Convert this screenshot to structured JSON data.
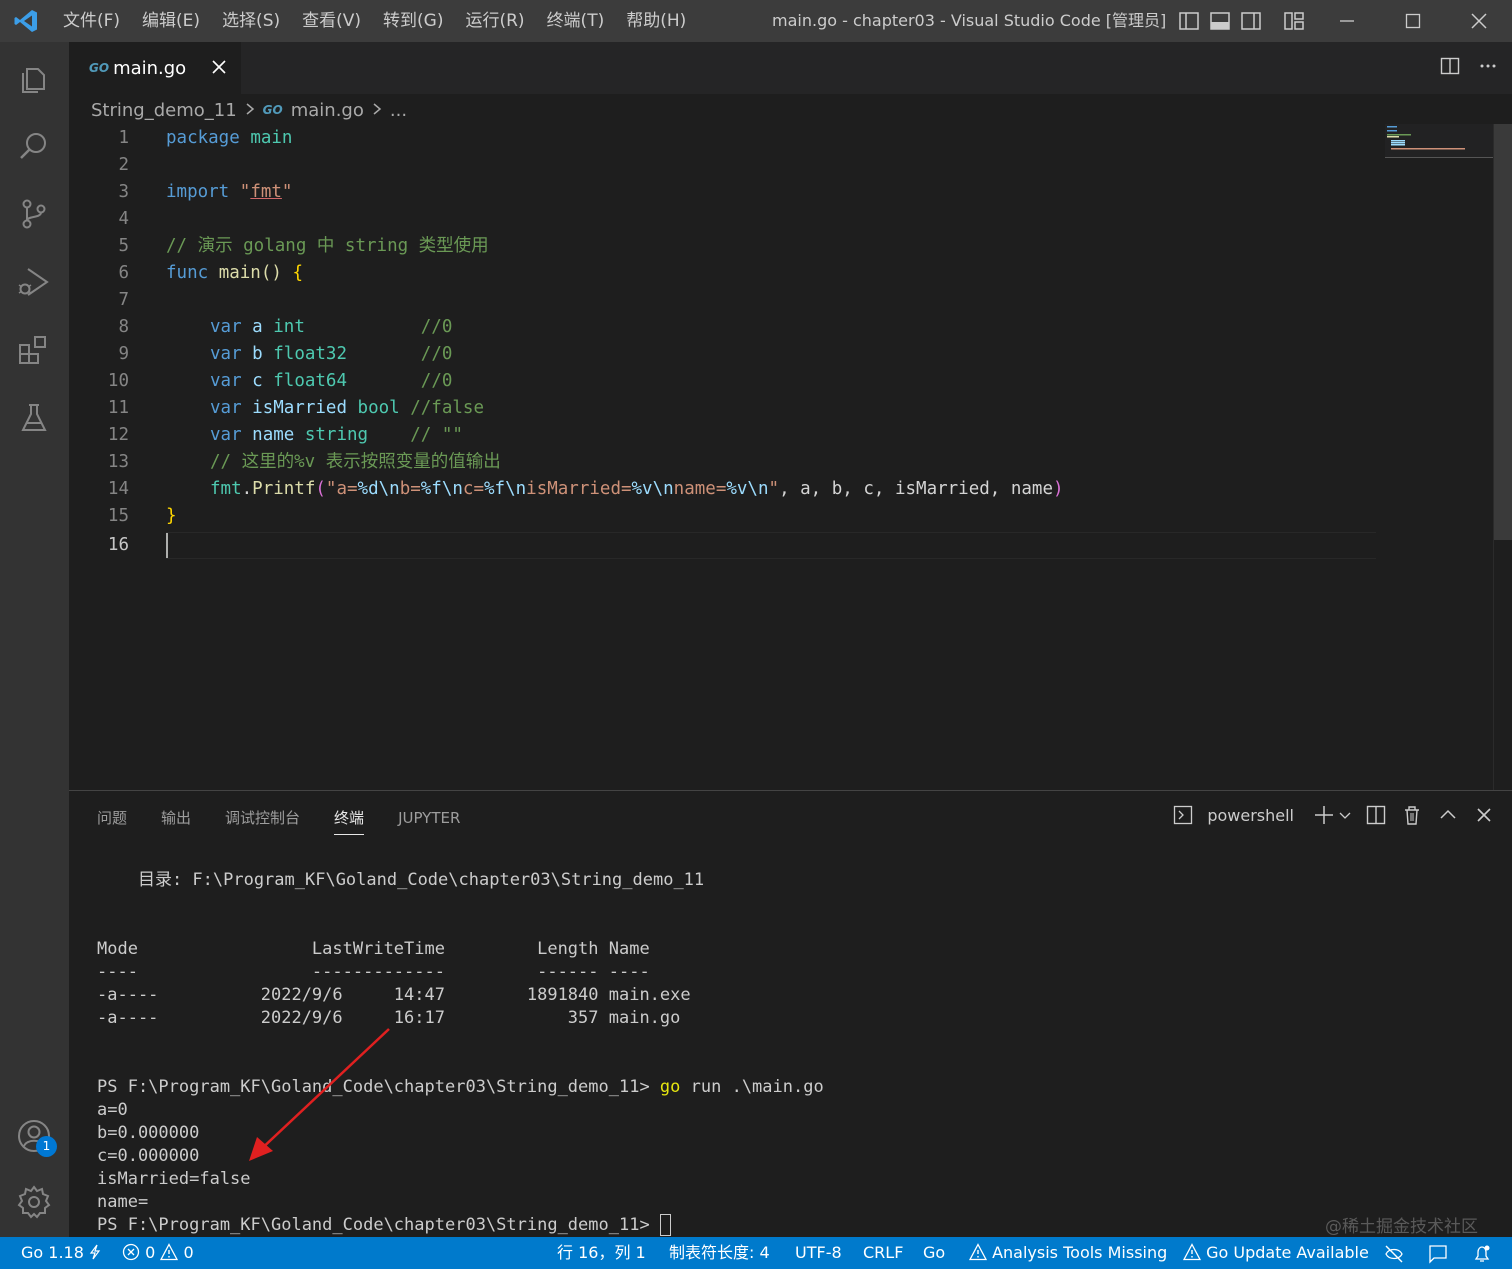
{
  "titlebar": {
    "menu": [
      "文件(F)",
      "编辑(E)",
      "选择(S)",
      "查看(V)",
      "转到(G)",
      "运行(R)",
      "终端(T)",
      "帮助(H)"
    ],
    "title": "main.go - chapter03 - Visual Studio Code [管理员]"
  },
  "tab": {
    "label": "main.go",
    "icon": "go-file-icon"
  },
  "breadcrumb": {
    "folder": "String_demo_11",
    "file": "main.go",
    "more": "..."
  },
  "editor": {
    "line_numbers": [
      "1",
      "2",
      "3",
      "4",
      "5",
      "6",
      "7",
      "8",
      "9",
      "10",
      "11",
      "12",
      "13",
      "14",
      "15",
      "16"
    ],
    "active_line": 16,
    "code": {
      "l1_kw": "package",
      "l1_id": "main",
      "l3_kw": "import",
      "l3_q1": "\"",
      "l3_str": "fmt",
      "l3_q2": "\"",
      "l5": "// 演示 golang 中 string 类型使用",
      "l6_kw": "func",
      "l6_fn": "main",
      "l6_paren": "() ",
      "l6_brace": "{",
      "l8_kw": "var",
      "l8_id": "a",
      "l8_ty": "int",
      "l8_cm": "//0",
      "l9_kw": "var",
      "l9_id": "b",
      "l9_ty": "float32",
      "l9_cm": "//0",
      "l10_kw": "var",
      "l10_id": "c",
      "l10_ty": "float64",
      "l10_cm": "//0",
      "l11_kw": "var",
      "l11_id": "isMarried",
      "l11_ty": "bool",
      "l11_cm": "//false",
      "l12_kw": "var",
      "l12_id": "name",
      "l12_ty": "string",
      "l12_cm": "// \"\"",
      "l13": "// 这里的%v 表示按照变量的值输出",
      "l14_pkg": "fmt",
      "l14_dot": ".",
      "l14_fn": "Printf",
      "l14_open": "(",
      "l14_s1": "\"a=",
      "l14_e1": "%d\\n",
      "l14_s2": "b=",
      "l14_e2": "%f\\n",
      "l14_s3": "c=",
      "l14_e3": "%f\\n",
      "l14_s4": "isMarried=",
      "l14_e4": "%v\\n",
      "l14_s5": "name=",
      "l14_e5": "%v\\n",
      "l14_s6": "\"",
      "l14_args": ", a, b, c, isMarried, name",
      "l14_close": ")",
      "l15_brace": "}"
    }
  },
  "panel": {
    "tabs": [
      "问题",
      "输出",
      "调试控制台",
      "终端",
      "JUPYTER"
    ],
    "active_tab": "终端",
    "shell": "powershell"
  },
  "terminal": {
    "dir_line": "    目录: F:\\Program_KF\\Goland_Code\\chapter03\\String_demo_11",
    "header": "Mode                 LastWriteTime         Length Name",
    "divider": "----                 -------------         ------ ----",
    "row1": "-a----          2022/9/6     14:47        1891840 main.exe",
    "row2": "-a----          2022/9/6     16:17            357 main.go",
    "prompt": "PS F:\\Program_KF\\Goland_Code\\chapter03\\String_demo_11> ",
    "cmd_go": "go",
    "cmd_rest": " run .\\main.go",
    "out1": "a=0",
    "out2": "b=0.000000",
    "out3": "c=0.000000",
    "out4": "isMarried=false",
    "out5": "name=",
    "prompt2": "PS F:\\Program_KF\\Goland_Code\\chapter03\\String_demo_11> "
  },
  "watermark": "@稀土掘金技术社区",
  "statusbar": {
    "go_version": "Go 1.18",
    "errors": "0",
    "warnings": "0",
    "position": "行 16，列 1",
    "tab_size": "制表符长度: 4",
    "encoding": "UTF-8",
    "eol": "CRLF",
    "language": "Go",
    "analysis": "Analysis Tools Missing",
    "update": "Go Update Available"
  },
  "accounts_badge": "1",
  "colors": {
    "statusbar": "#007acc",
    "activitybar": "#333333",
    "titlebar": "#3c3c3c",
    "editor": "#1e1e1e"
  }
}
